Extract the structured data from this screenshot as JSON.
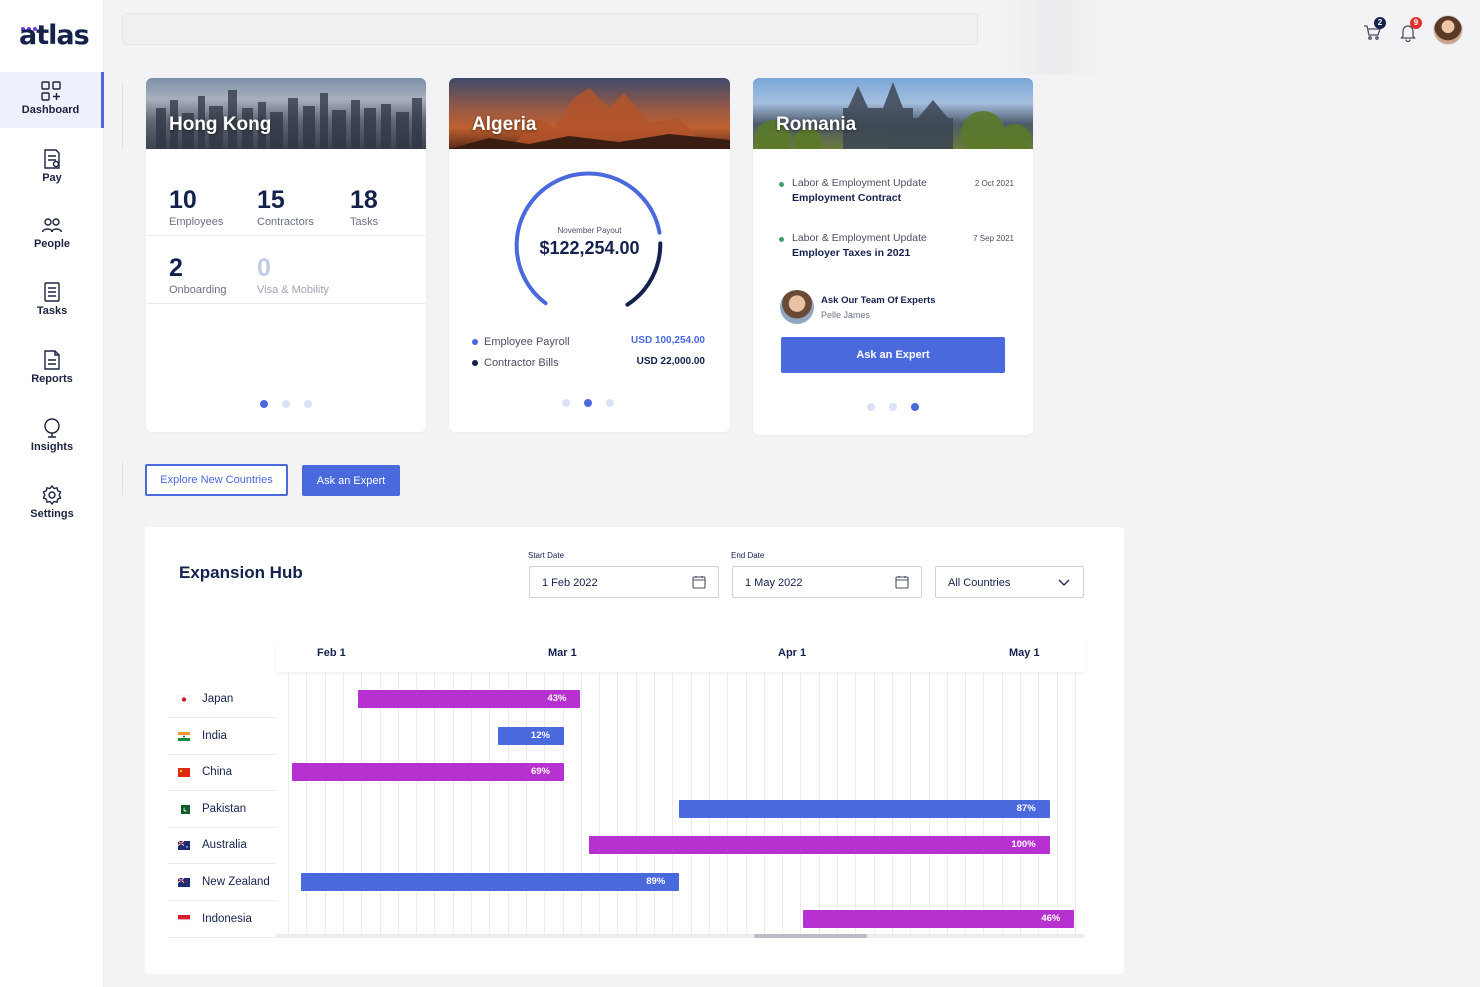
{
  "app": {
    "logo": "atlas"
  },
  "sidebar": {
    "items": [
      {
        "label": "Dashboard",
        "icon": "dashboard-icon",
        "active": true
      },
      {
        "label": "Pay",
        "icon": "pay-icon"
      },
      {
        "label": "People",
        "icon": "people-icon"
      },
      {
        "label": "Tasks",
        "icon": "tasks-icon"
      },
      {
        "label": "Reports",
        "icon": "reports-icon"
      },
      {
        "label": "Insights",
        "icon": "insights-icon"
      },
      {
        "label": "Settings",
        "icon": "gear-icon"
      }
    ]
  },
  "topbar": {
    "cart_count": "2",
    "notification_count": "9",
    "colors": {
      "cart_badge": "#14214d",
      "notif_badge": "#e0322f"
    }
  },
  "cards": {
    "hong_kong": {
      "title": "Hong Kong",
      "stats": [
        {
          "value": "10",
          "label": "Employees"
        },
        {
          "value": "15",
          "label": "Contractors"
        },
        {
          "value": "18",
          "label": "Tasks"
        },
        {
          "value": "2",
          "label": "Onboarding"
        },
        {
          "value": "0",
          "label": "Visa & Mobility"
        }
      ]
    },
    "algeria": {
      "title": "Algeria",
      "gauge_label": "November Payout",
      "gauge_value": "$122,254.00",
      "rows": [
        {
          "label": "Employee Payroll",
          "amount": "USD 100,254.00",
          "color": "#4a69dd"
        },
        {
          "label": "Contractor Bills",
          "amount": "USD 22,000.00",
          "color": "#14214d"
        }
      ]
    },
    "romania": {
      "title": "Romania",
      "news": [
        {
          "category": "Labor & Employment Update",
          "title": "Employment Contract",
          "date": "2 Oct 2021"
        },
        {
          "category": "Labor & Employment Update",
          "title": "Employer Taxes in 2021",
          "date": "7 Sep 2021"
        }
      ],
      "expert_heading": "Ask Our Team Of Experts",
      "expert_name": "Pelle James",
      "expert_button": "Ask an Expert"
    }
  },
  "actions": {
    "explore": "Explore New Countries",
    "ask_expert": "Ask an Expert"
  },
  "hub": {
    "title": "Expansion Hub",
    "start_label": "Start Date",
    "start_value": "1 Feb 2022",
    "end_label": "End Date",
    "end_value": "1 May 2022",
    "filter_value": "All Countries"
  },
  "chart_data": {
    "type": "gantt",
    "months": [
      "Feb 1",
      "Mar 1",
      "Apr 1",
      "May 1"
    ],
    "colors": {
      "magenta": "#b731d0",
      "blue": "#4a69dd"
    },
    "rows": [
      {
        "country": "Japan",
        "start": "2022-02-06",
        "end": "2022-03-05",
        "progress": "43%",
        "color": "magenta"
      },
      {
        "country": "India",
        "start": "2022-02-23",
        "end": "2022-03-03",
        "progress": "12%",
        "color": "blue"
      },
      {
        "country": "China",
        "start": "2022-01-29",
        "end": "2022-03-03",
        "progress": "69%",
        "color": "magenta"
      },
      {
        "country": "Pakistan",
        "start": "2022-03-17",
        "end": "2022-05-01",
        "progress": "87%",
        "color": "blue"
      },
      {
        "country": "Australia",
        "start": "2022-03-06",
        "end": "2022-05-01",
        "progress": "100%",
        "color": "magenta"
      },
      {
        "country": "New Zealand",
        "start": "2022-01-30",
        "end": "2022-03-17",
        "progress": "89%",
        "color": "blue"
      },
      {
        "country": "Indonesia",
        "start": "2022-04-01",
        "end": "2022-05-04",
        "progress": "46%",
        "color": "magenta"
      }
    ]
  }
}
